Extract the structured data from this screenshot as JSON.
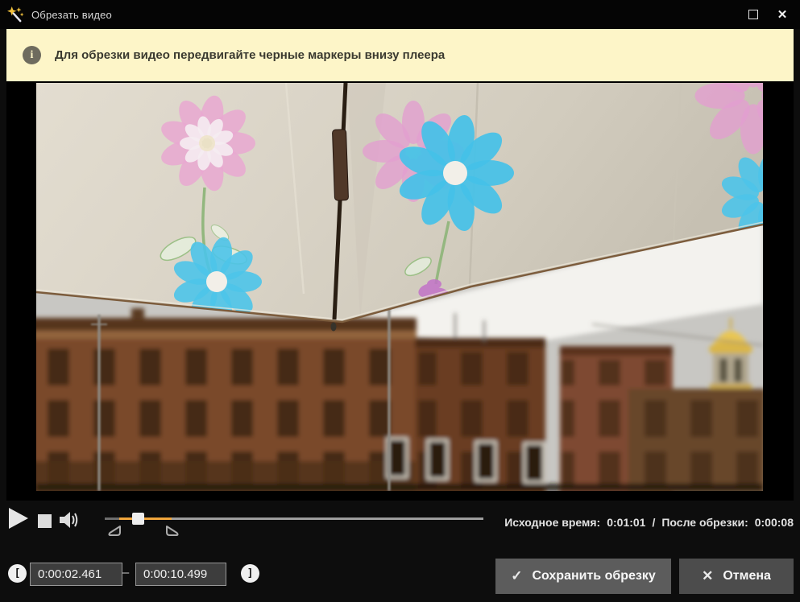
{
  "window": {
    "title": "Обрезать видео",
    "close_glyph": "✕"
  },
  "banner": {
    "icon_glyph": "i",
    "text": "Для обрезки видео передвигайте черные маркеры внизу плеера"
  },
  "controls": {
    "time_info": {
      "source_label": "Исходное время:",
      "source_value": "0:01:01",
      "separator": "/",
      "trimmed_label": "После обрезки:",
      "trimmed_value": "0:00:08"
    }
  },
  "footer": {
    "set_start_glyph": "[",
    "set_end_glyph": "]",
    "start_time": "0:00:02.461",
    "range_separator": "–",
    "end_time": "0:00:10.499",
    "save": {
      "icon_glyph": "✓",
      "label": "Сохранить обрезку"
    },
    "cancel": {
      "icon_glyph": "✕",
      "label": "Отмена"
    }
  },
  "colors": {
    "accent_orange": "#F0A53C",
    "banner_bg": "#FDF5C8",
    "banner_text": "#3A3A30",
    "window_bg": "#0D0D0D",
    "save_button_bg": "#5C5C5C",
    "cancel_button_bg": "#4C4C4C"
  }
}
